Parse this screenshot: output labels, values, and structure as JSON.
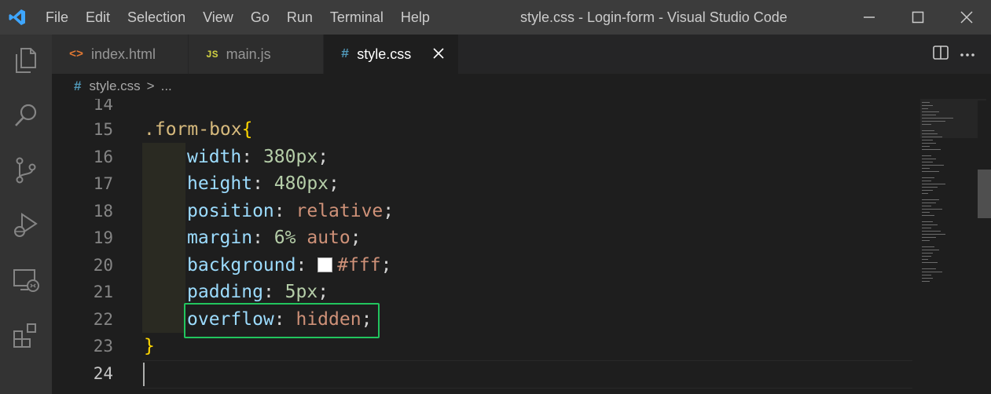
{
  "titlebar": {
    "menu": [
      "File",
      "Edit",
      "Selection",
      "View",
      "Go",
      "Run",
      "Terminal",
      "Help"
    ],
    "window_title": "style.css - Login-form - Visual Studio Code"
  },
  "activity_bar": [
    "files-icon",
    "search-icon",
    "source-control-icon",
    "run-debug-icon",
    "remote-explorer-icon",
    "extensions-icon"
  ],
  "tabs": [
    {
      "label": "index.html",
      "icon": "<>",
      "icon_color": "#e37933"
    },
    {
      "label": "main.js",
      "icon": "JS",
      "icon_color": "#cbcb41"
    },
    {
      "label": "style.css",
      "icon": "#",
      "icon_color": "#519aba",
      "active": true
    }
  ],
  "breadcrumb": {
    "file": "style.css",
    "separator": ">",
    "rest": "..."
  },
  "editor": {
    "line_numbers": [
      "14",
      "15",
      "16",
      "17",
      "18",
      "19",
      "20",
      "21",
      "22",
      "23",
      "24"
    ],
    "lines": {
      "l15": {
        "selector": ".form-box",
        "brace": "{"
      },
      "l16": {
        "prop": "width",
        "colon": ": ",
        "num": "380px",
        "semi": ";"
      },
      "l17": {
        "prop": "height",
        "colon": ": ",
        "num": "480px",
        "semi": ";"
      },
      "l18": {
        "prop": "position",
        "colon": ": ",
        "val": "relative",
        "semi": ";"
      },
      "l19": {
        "prop": "margin",
        "colon": ": ",
        "num": "6%",
        "space": " ",
        "val": "auto",
        "semi": ";"
      },
      "l20": {
        "prop": "background",
        "colon": ": ",
        "val": "#fff",
        "semi": ";"
      },
      "l21": {
        "prop": "padding",
        "colon": ": ",
        "num": "5px",
        "semi": ";"
      },
      "l22": {
        "prop": "overflow",
        "colon": ": ",
        "val": "hidden",
        "semi": ";"
      },
      "l23": {
        "brace": "}"
      }
    },
    "current_line": "24",
    "highlighted_line": "22",
    "highlight_color": "#22c55e"
  }
}
